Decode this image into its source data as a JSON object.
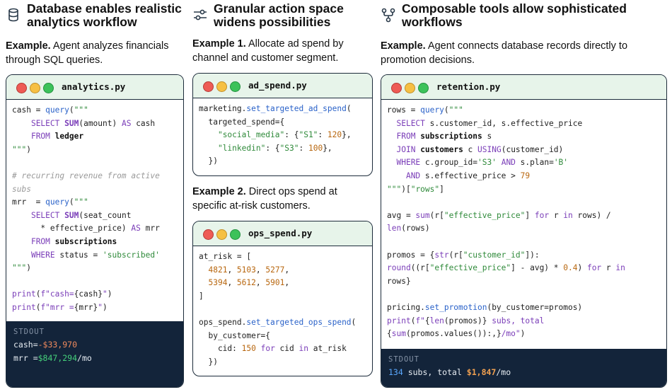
{
  "columns": [
    {
      "title": "Database enables realistic analytics workflow",
      "icon": "database-icon",
      "intro_bold": "Example.",
      "intro_text": " Agent analyzes financials through SQL queries.",
      "file": "analytics.py",
      "stdout_label": "STDOUT",
      "stdout": {
        "line1_prefix": "cash=",
        "line1_value": "-$33,970",
        "line2_prefix": "mrr =",
        "line2_value": "$847,294",
        "line2_suffix": "/mo"
      }
    },
    {
      "title": "Granular action space widens possibilities",
      "icon": "sliders-icon",
      "example1_bold": "Example 1.",
      "example1_text": " Allocate ad spend by channel and customer segment.",
      "file1": "ad_spend.py",
      "example2_bold": "Example 2.",
      "example2_text": " Direct ops spend at specific at-risk customers.",
      "file2": "ops_spend.py"
    },
    {
      "title": "Composable tools allow sophisticated workflows",
      "icon": "workflow-icon",
      "intro_bold": "Example.",
      "intro_text": " Agent connects database records directly to promotion decisions.",
      "file": "retention.py",
      "stdout_label": "STDOUT",
      "stdout": {
        "count": "134",
        "mid": " subs, total ",
        "total": "$1,847",
        "suffix": "/mo"
      }
    }
  ],
  "colors": {
    "header_bar": "#e7f4ea",
    "border": "#1c2b3a",
    "stdout_bg": "#13243a"
  }
}
